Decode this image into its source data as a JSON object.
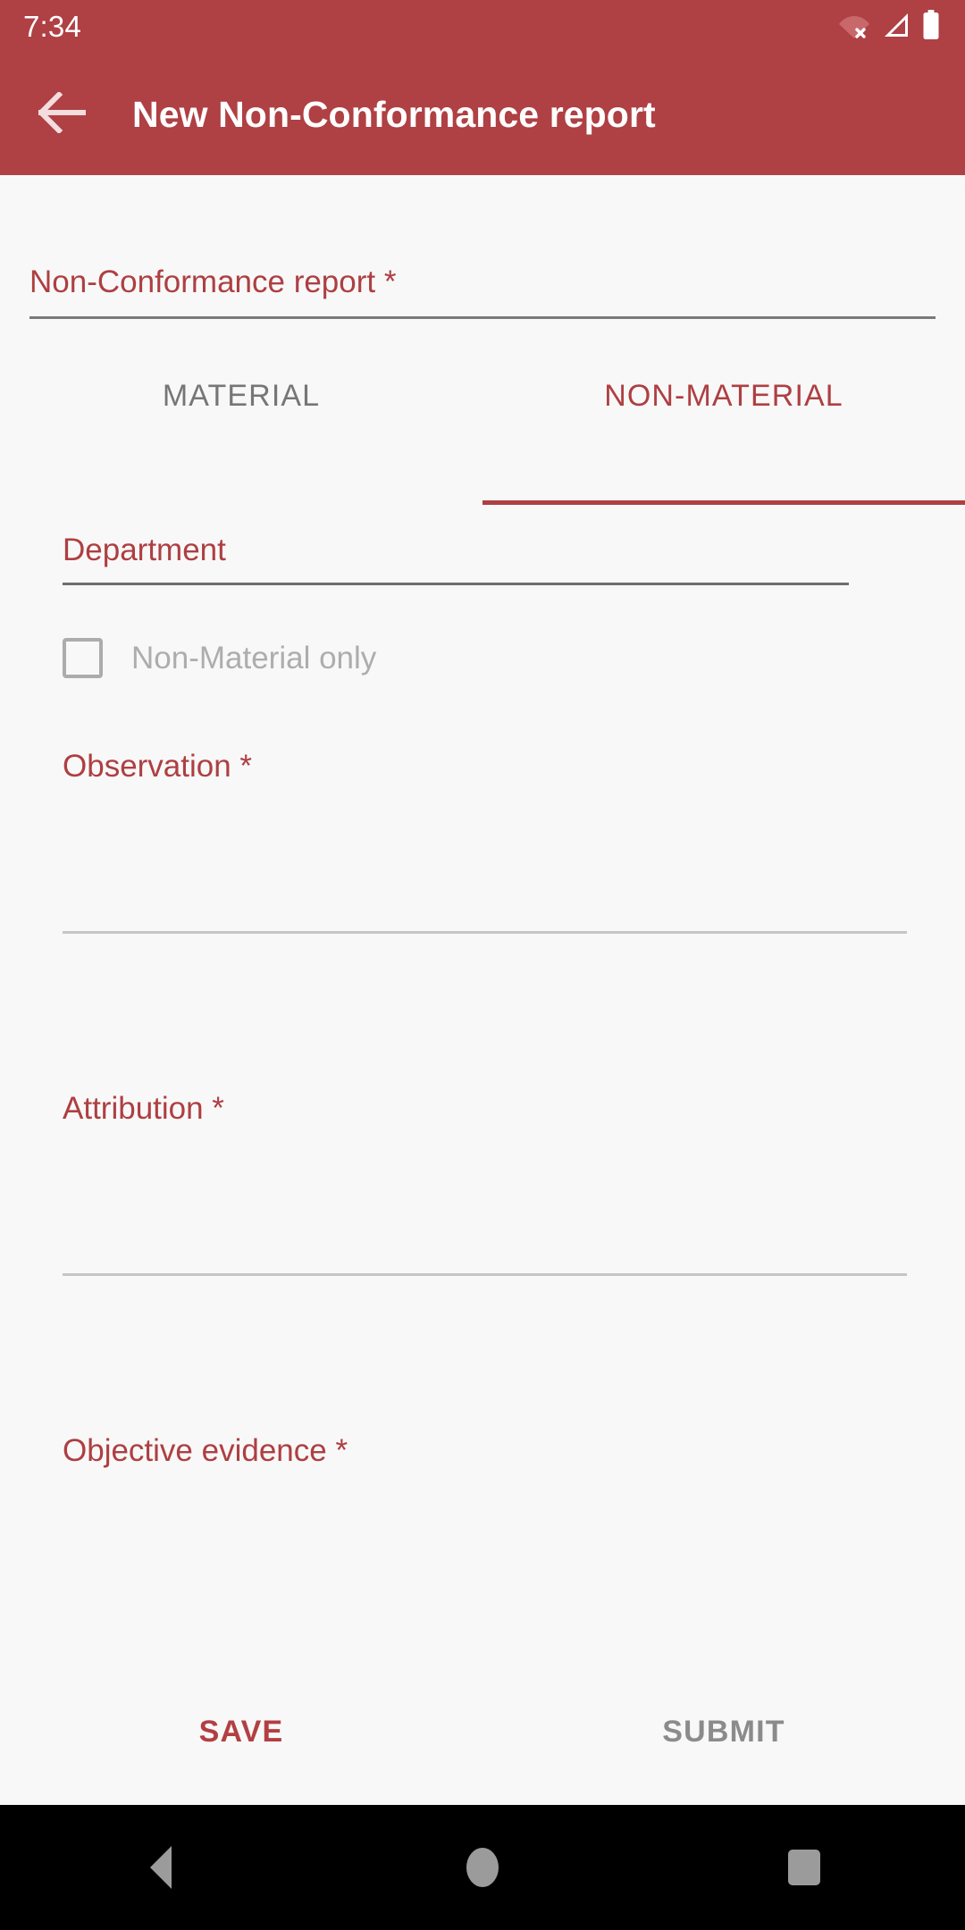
{
  "status_bar": {
    "time": "7:34",
    "icons": [
      {
        "name": "wifi-off-icon"
      },
      {
        "name": "cellular-signal-icon"
      },
      {
        "name": "battery-icon"
      }
    ]
  },
  "app_bar": {
    "back_icon": "arrow-back-icon",
    "title": "New Non-Conformance report",
    "background_color": "#AF4044",
    "title_color": "#FFFFFF"
  },
  "theme": {
    "accent_color": "#AE3F42",
    "background_color": "#F8F8F8",
    "muted_text_color": "#767676",
    "disabled_text_color": "#ADADAD",
    "divider_color": "#C6C6C6"
  },
  "form": {
    "report_picker": {
      "label": "Non-Conformance report *",
      "value": ""
    },
    "tabs": [
      {
        "label": "MATERIAL",
        "active": false
      },
      {
        "label": "NON-MATERIAL",
        "active": true
      }
    ],
    "department": {
      "label": "Department",
      "value": ""
    },
    "non_material_only": {
      "label": "Non-Material only",
      "checked": false
    },
    "observation": {
      "label": "Observation *",
      "value": ""
    },
    "attribution": {
      "label": "Attribution *",
      "value": ""
    },
    "objective_evidence": {
      "label": "Objective evidence *",
      "value": ""
    }
  },
  "actions": {
    "save_label": "SAVE",
    "submit_label": "SUBMIT"
  },
  "nav_bar": {
    "back_icon": "nav-back-icon",
    "home_icon": "nav-home-icon",
    "recents_icon": "nav-recents-icon"
  }
}
